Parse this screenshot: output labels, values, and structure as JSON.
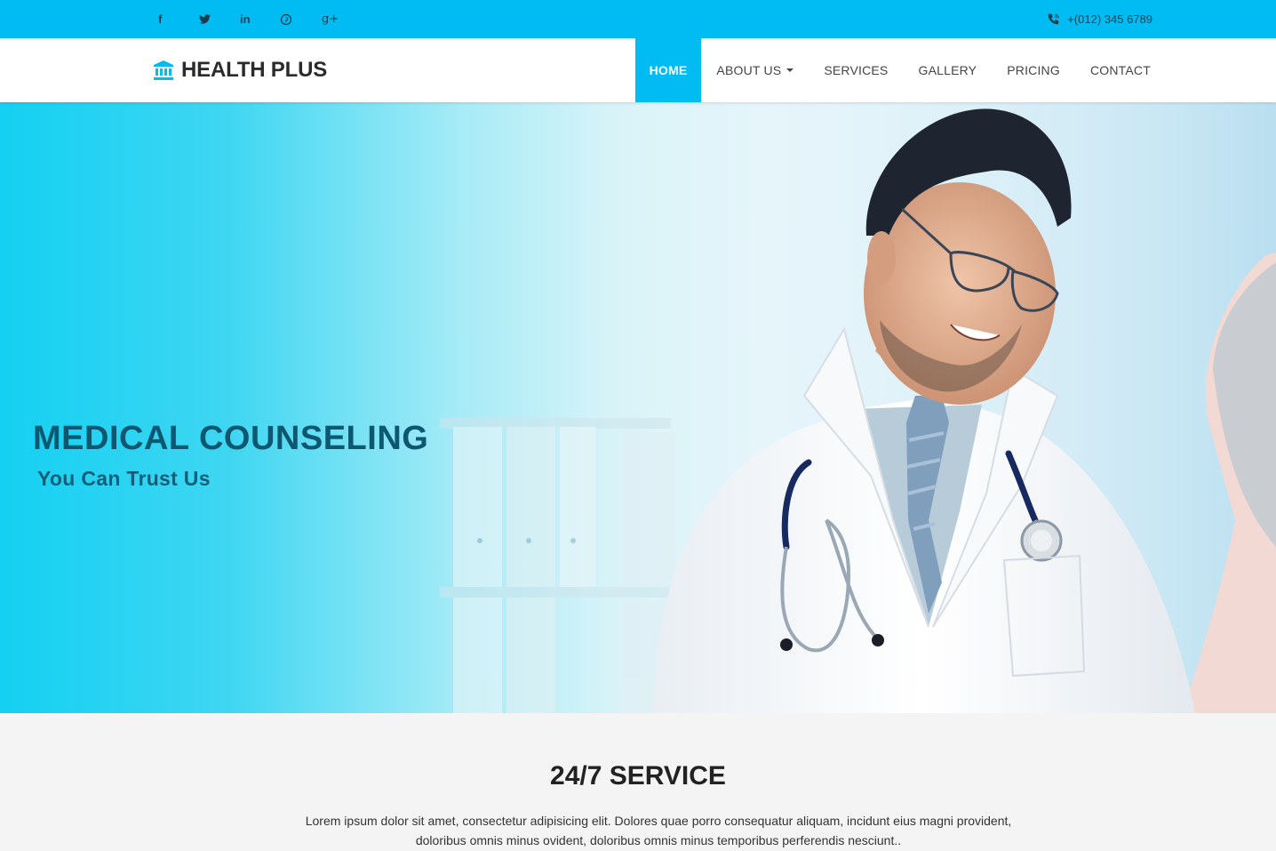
{
  "topbar": {
    "social": [
      {
        "name": "facebook-icon",
        "glyph": "f"
      },
      {
        "name": "twitter-icon",
        "glyph": ""
      },
      {
        "name": "linkedin-icon",
        "glyph": "in"
      },
      {
        "name": "pinterest-icon",
        "glyph": ""
      },
      {
        "name": "google-plus-icon",
        "glyph": "g+"
      }
    ],
    "phone": "+(012) 345 6789"
  },
  "brand": {
    "name": "HEALTH PLUS",
    "icon": "institution-icon"
  },
  "nav": {
    "items": [
      {
        "label": "HOME",
        "active": true
      },
      {
        "label": "ABOUT US",
        "dropdown": true
      },
      {
        "label": "SERVICES"
      },
      {
        "label": "GALLERY"
      },
      {
        "label": "PRICING"
      },
      {
        "label": "CONTACT"
      }
    ]
  },
  "hero": {
    "title": "MEDICAL COUNSELING",
    "subtitle": "You Can Trust Us"
  },
  "service": {
    "title": "24/7 SERVICE",
    "text_line1": "Lorem ipsum dolor sit amet, consectetur adipisicing elit. Dolores quae porro consequatur aliquam, incidunt eius magni provident,",
    "text_line2": "doloribus omnis minus ovident, doloribus omnis minus temporibus perferendis nesciunt.."
  },
  "colors": {
    "accent": "#00bcf2",
    "hero_title": "#0d5870",
    "background": "#f4f4f4"
  }
}
